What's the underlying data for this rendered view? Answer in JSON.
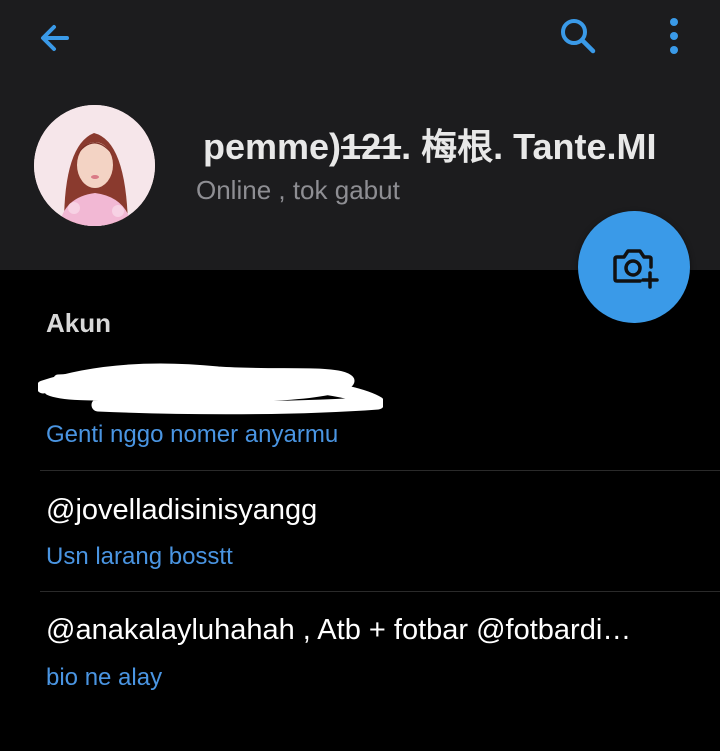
{
  "colors": {
    "header_bg": "#1c1c1e",
    "page_bg": "#000000",
    "accent": "#3a9ae8",
    "link_text": "#4a95e2",
    "muted_text": "#8e8e93"
  },
  "header": {
    "back_icon": "arrow-left-icon",
    "search_icon": "search-icon",
    "more_icon": "more-vertical-icon"
  },
  "profile": {
    "name_prefix": "pemme)",
    "name_struck": "121",
    "name_suffix": ". 梅根. Tante.MI",
    "status": "Online , tok gabut",
    "fab_icon": "add-photo-icon"
  },
  "account": {
    "section_title": "Akun",
    "phone_hint": "Genti nggo nomer anyarmu",
    "username": "@jovelladisinisyangg",
    "username_hint": "Usn larang bosstt",
    "bio": "@anakalayluhahah , Atb + fotbar @fotbardi…",
    "bio_hint": "bio ne alay"
  }
}
